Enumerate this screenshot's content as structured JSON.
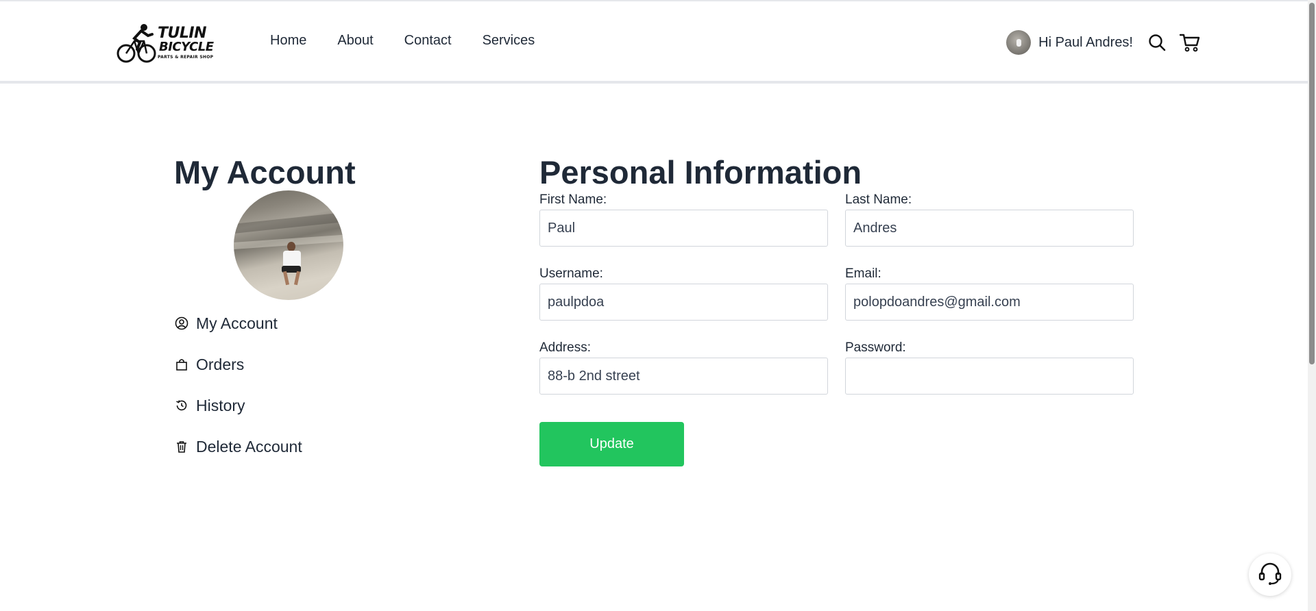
{
  "header": {
    "logo": {
      "line1": "TULIN",
      "line2": "BICYCLE",
      "line3": "PARTS & REPAIR SHOP"
    },
    "nav": [
      "Home",
      "About",
      "Contact",
      "Services"
    ],
    "greeting": "Hi Paul Andres!"
  },
  "sidebar": {
    "title": "My Account",
    "items": [
      {
        "label": "My Account",
        "icon": "user-circle-icon"
      },
      {
        "label": "Orders",
        "icon": "shopping-bag-icon"
      },
      {
        "label": "History",
        "icon": "history-icon"
      },
      {
        "label": "Delete Account",
        "icon": "trash-icon"
      }
    ]
  },
  "main": {
    "title": "Personal Information",
    "fields": {
      "first_name": {
        "label": "First Name:",
        "value": "Paul"
      },
      "last_name": {
        "label": "Last Name:",
        "value": "Andres"
      },
      "username": {
        "label": "Username:",
        "value": "paulpdoa"
      },
      "email": {
        "label": "Email:",
        "value": "polopdoandres@gmail.com"
      },
      "address": {
        "label": "Address:",
        "value": "88-b 2nd street"
      },
      "password": {
        "label": "Password:",
        "value": ""
      }
    },
    "update_label": "Update"
  },
  "colors": {
    "accent": "#22c55e",
    "text": "#1f2937",
    "border": "#d1d5db"
  }
}
